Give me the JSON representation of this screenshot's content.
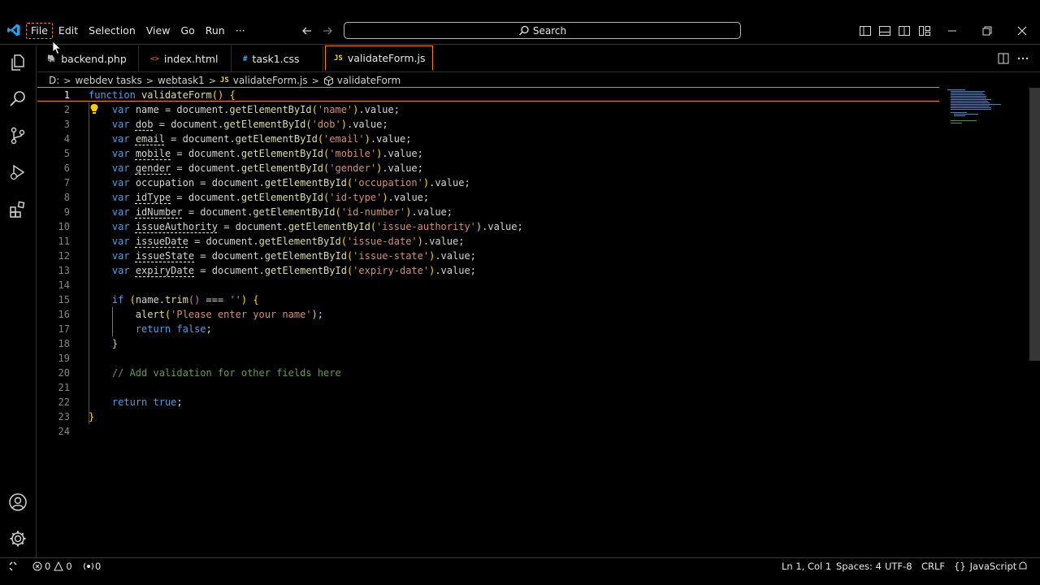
{
  "menu": [
    "File",
    "Edit",
    "Selection",
    "View",
    "Go",
    "Run",
    "···"
  ],
  "search": {
    "label": "Search"
  },
  "tabs": [
    {
      "name": "backend.php",
      "icon": "php-icon"
    },
    {
      "name": "index.html",
      "icon": "<>"
    },
    {
      "name": "task1.css",
      "icon": "#"
    },
    {
      "name": "validateForm.js",
      "icon": "JS",
      "active": true
    }
  ],
  "breadcrumb": [
    "D:",
    "webdev tasks",
    "webtask1",
    "validateForm.js",
    "validateForm"
  ],
  "editor": {
    "current_line": 1,
    "lines": [
      "function validateForm() {",
      "    var name = document.getElementById('name').value;",
      "    var dob = document.getElementById('dob').value;",
      "    var email = document.getElementById('email').value;",
      "    var mobile = document.getElementById('mobile').value;",
      "    var gender = document.getElementById('gender').value;",
      "    var occupation = document.getElementById('occupation').value;",
      "    var idType = document.getElementById('id-type').value;",
      "    var idNumber = document.getElementById('id-number').value;",
      "    var issueAuthority = document.getElementById('issue-authority').value;",
      "    var issueDate = document.getElementById('issue-date').value;",
      "    var issueState = document.getElementById('issue-state').value;",
      "    var expiryDate = document.getElementById('expiry-date').value;",
      "",
      "    if (name.trim() === '') {",
      "        alert('Please enter your name');",
      "        return false;",
      "    }",
      "",
      "    // Add validation for other fields here",
      "",
      "    return true;",
      "}",
      ""
    ]
  },
  "statusbar": {
    "errors": "0",
    "warnings": "0",
    "ports": "0",
    "position": "Ln 1, Col 1",
    "spaces": "Spaces: 4",
    "encoding": "UTF-8",
    "eol": "CRLF",
    "language": "JavaScript"
  }
}
